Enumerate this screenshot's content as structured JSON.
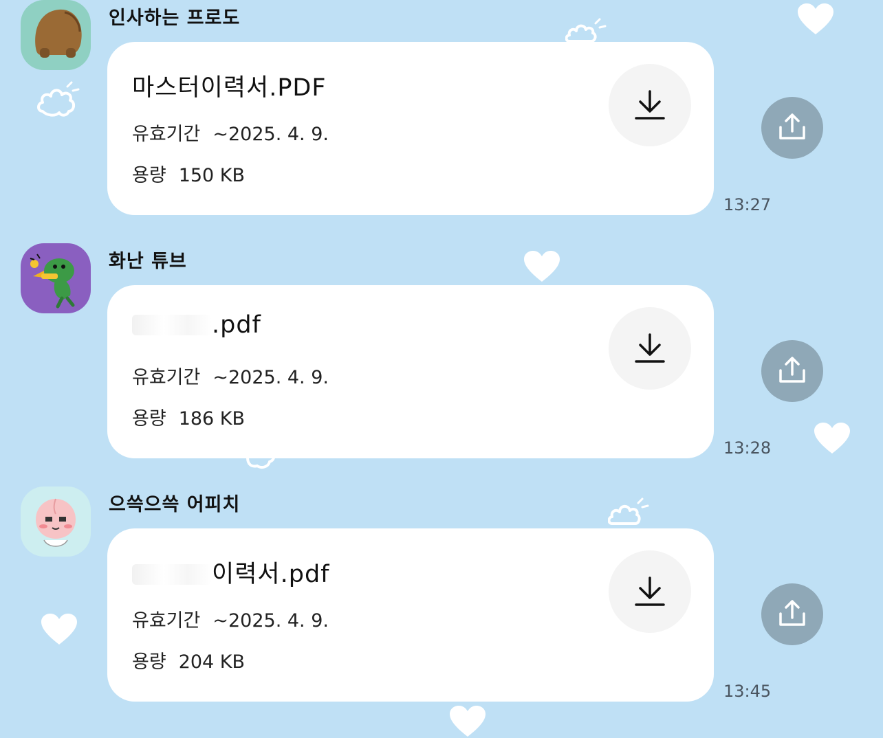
{
  "theme": {
    "background": "#bfe0f5",
    "bubble": "#ffffff",
    "share_button": "#8fa8b7",
    "download_button": "#f4f4f4"
  },
  "messages": [
    {
      "sender": "인사하는 프로도",
      "avatar_icon": "frodo-dog-avatar-icon",
      "file_name_visible": "마스터이력서.PDF",
      "file_name_redacted": false,
      "expiry_label": "유효기간",
      "expiry_value": "~2025. 4. 9.",
      "size_label": "용량",
      "size_value": "150 KB",
      "time": "13:27"
    },
    {
      "sender": "화난 튜브",
      "avatar_icon": "tube-duck-avatar-icon",
      "file_name_visible": ".pdf",
      "file_name_redacted": true,
      "expiry_label": "유효기간",
      "expiry_value": "~2025. 4. 9.",
      "size_label": "용량",
      "size_value": "186 KB",
      "time": "13:28"
    },
    {
      "sender": "으쓱으쓱 어피치",
      "avatar_icon": "apeach-peach-avatar-icon",
      "file_name_visible": "이력서.pdf",
      "file_name_redacted": true,
      "expiry_label": "유효기간",
      "expiry_value": "~2025. 4. 9.",
      "size_label": "용량",
      "size_value": "204 KB",
      "time": "13:45"
    }
  ],
  "icons": {
    "download": "download-icon",
    "share": "share-icon"
  }
}
